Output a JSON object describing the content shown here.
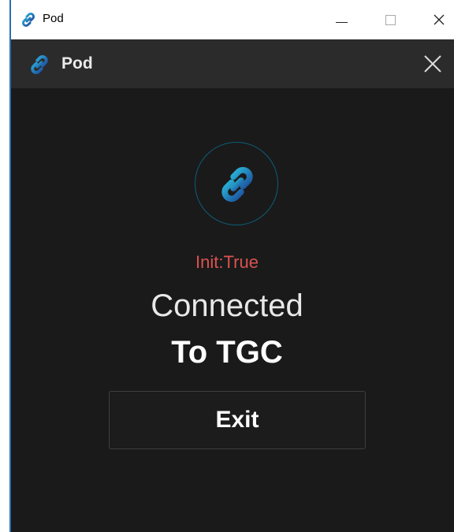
{
  "window": {
    "title": "Pod"
  },
  "header": {
    "title": "Pod"
  },
  "main": {
    "status_text": "Init:True",
    "connected_line1": "Connected",
    "connected_line2": "To TGC",
    "exit_label": "Exit"
  },
  "icons": {
    "app": "link-icon",
    "close": "close-icon",
    "minimize": "minimize-icon",
    "maximize": "maximize-icon"
  },
  "colors": {
    "status": "#d9534f",
    "background": "#1a1a1b",
    "header": "#2b2b2c",
    "link_gradient_start": "#2aa8d8",
    "link_gradient_end": "#1d4f9c"
  }
}
